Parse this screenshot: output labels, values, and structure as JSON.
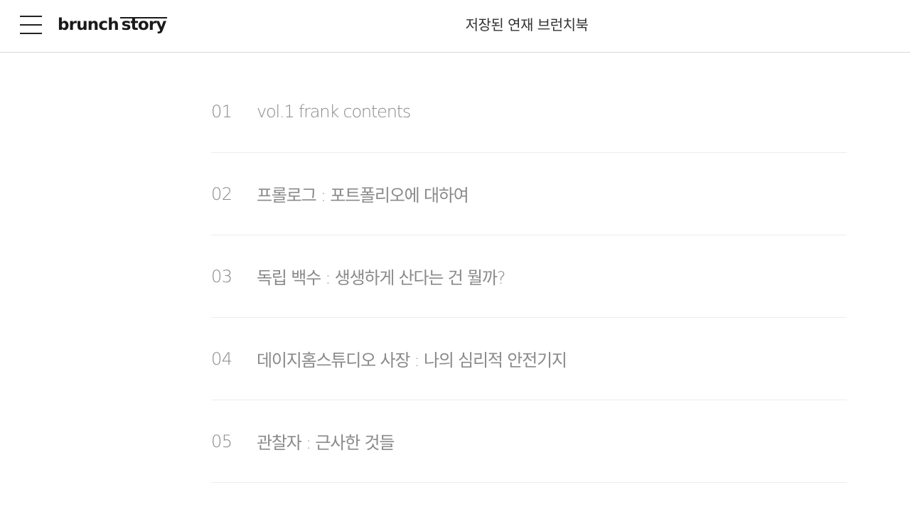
{
  "header": {
    "menu_icon": "hamburger-menu-icon",
    "logo": {
      "part1": "brunch",
      "part2": "story"
    },
    "title": "저장된 연재 브런치북"
  },
  "toc": {
    "items": [
      {
        "number": "01",
        "title": "vol.1 frank contents"
      },
      {
        "number": "02",
        "title": "프롤로그 : 포트폴리오에 대하여"
      },
      {
        "number": "03",
        "title": "독립 백수 : 생생하게 산다는 건 뭘까?"
      },
      {
        "number": "04",
        "title": "데이지홈스튜디오 사장 : 나의 심리적 안전기지"
      },
      {
        "number": "05",
        "title": "관찰자 : 근사한 것들"
      }
    ]
  }
}
